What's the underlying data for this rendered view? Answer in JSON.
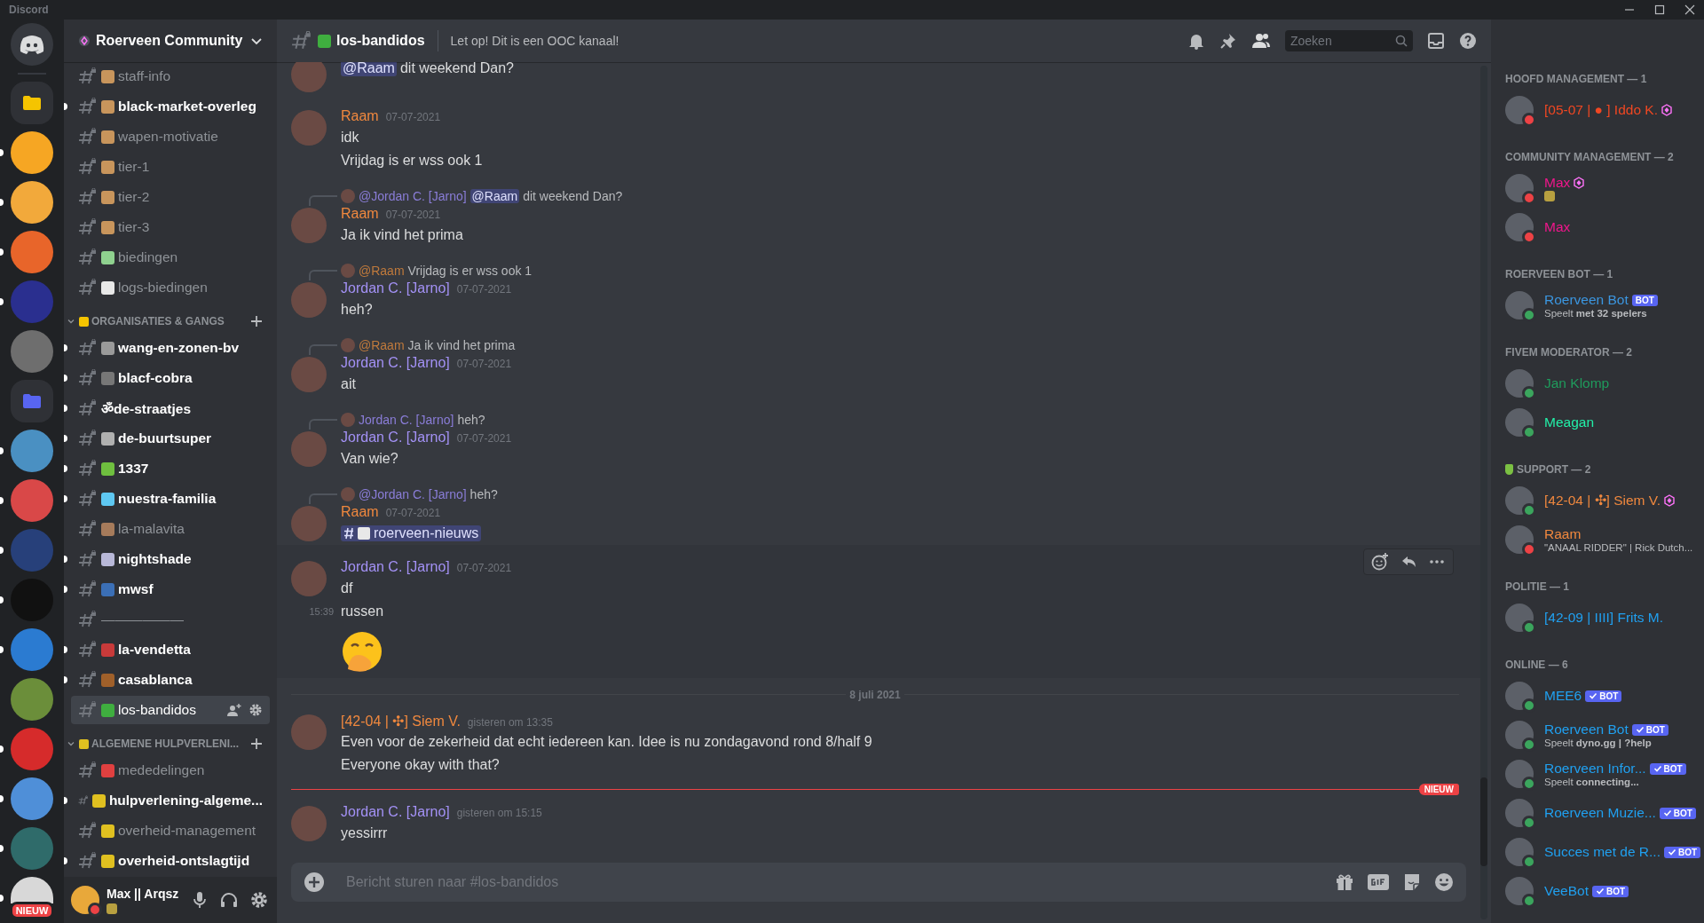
{
  "window": {
    "title": "Discord"
  },
  "servers": [
    {
      "kind": "home",
      "unread": false,
      "color": "#36393f"
    },
    {
      "kind": "folder",
      "unread": false,
      "color": "#f5c400"
    },
    {
      "kind": "server",
      "unread": true,
      "color": "#f6a623"
    },
    {
      "kind": "server",
      "unread": true,
      "color": "#f2a93b"
    },
    {
      "kind": "server",
      "unread": true,
      "color": "#e8652a"
    },
    {
      "kind": "server",
      "unread": true,
      "color": "#2a2f8f"
    },
    {
      "kind": "server",
      "unread": false,
      "color": "#6e6e6e"
    },
    {
      "kind": "folder",
      "unread": false,
      "color": "#5865f2"
    },
    {
      "kind": "server",
      "unread": true,
      "color": "#4a90c2"
    },
    {
      "kind": "server",
      "unread": true,
      "color": "#d94848"
    },
    {
      "kind": "server",
      "unread": true,
      "color": "#27407a"
    },
    {
      "kind": "server",
      "unread": true,
      "color": "#111111"
    },
    {
      "kind": "server",
      "unread": true,
      "color": "#2b7bd1"
    },
    {
      "kind": "server",
      "unread": false,
      "color": "#6b8e3a"
    },
    {
      "kind": "server",
      "unread": true,
      "color": "#d62b2b"
    },
    {
      "kind": "server",
      "unread": true,
      "color": "#4f8fd8"
    },
    {
      "kind": "server",
      "unread": true,
      "color": "#2f6b6a"
    },
    {
      "kind": "server",
      "unread": true,
      "color": "#d8d8d8",
      "badge": "NIEUW"
    }
  ],
  "server": {
    "name": "Roerveen Community"
  },
  "sections": [
    {
      "channels": [
        {
          "name": "staff-info",
          "unread": false,
          "selected": false,
          "color": "#c8955c"
        },
        {
          "name": "black-market-overleg",
          "unread": true,
          "selected": false,
          "color": "#c8955c"
        },
        {
          "name": "wapen-motivatie",
          "unread": false,
          "selected": false,
          "color": "#c8955c"
        },
        {
          "name": "tier-1",
          "unread": false,
          "selected": false,
          "color": "#c8955c"
        },
        {
          "name": "tier-2",
          "unread": false,
          "selected": false,
          "color": "#c8955c"
        },
        {
          "name": "tier-3",
          "unread": false,
          "selected": false,
          "color": "#c8955c"
        },
        {
          "name": "biedingen",
          "unread": false,
          "selected": false,
          "color": "#8fd18f"
        },
        {
          "name": "logs-biedingen",
          "unread": false,
          "selected": false,
          "color": "#e8e8e8"
        }
      ]
    },
    {
      "title": "ORGANISATIES & GANGS",
      "expanded": true,
      "color": "#f5c400",
      "channels": [
        {
          "name": "wang-en-zonen-bv",
          "unread": true,
          "selected": false,
          "color": "#9a9a9a"
        },
        {
          "name": "blacf-cobra",
          "unread": true,
          "selected": false,
          "color": "#777777"
        },
        {
          "name": "ॐde-straatjes",
          "unread": true,
          "selected": false
        },
        {
          "name": "de-buurtsuper",
          "unread": true,
          "selected": false,
          "color": "#b0b0b0"
        },
        {
          "name": "1337",
          "unread": true,
          "selected": false,
          "color": "#6fbf3f"
        },
        {
          "name": "nuestra-familia",
          "unread": true,
          "selected": false,
          "color": "#5ec8f2"
        },
        {
          "name": "la-malavita",
          "unread": false,
          "selected": false,
          "color": "#a67b5b"
        },
        {
          "name": "nightshade",
          "unread": true,
          "selected": false,
          "color": "#b8b8d8"
        },
        {
          "name": "mwsf",
          "unread": true,
          "selected": false,
          "color": "#3b6fb6"
        },
        {
          "name": "——————",
          "unread": false,
          "selected": false
        },
        {
          "name": "la-vendetta",
          "unread": true,
          "selected": false,
          "color": "#c83a3a"
        },
        {
          "name": "casablanca",
          "unread": true,
          "selected": false,
          "color": "#a0602a"
        },
        {
          "name": "los-bandidos",
          "unread": false,
          "selected": true,
          "color": "#3fae3f"
        }
      ]
    },
    {
      "title": "ALGEMENE HULPVERLENI...",
      "expanded": true,
      "color": "#e0c020",
      "channels": [
        {
          "name": "mededelingen",
          "unread": false,
          "selected": false,
          "color": "#e04040"
        },
        {
          "name": "hulpverlening-algeme...",
          "unread": true,
          "selected": false,
          "color": "#e0c020"
        },
        {
          "name": "overheid-management",
          "unread": false,
          "selected": false,
          "color": "#e0c020"
        },
        {
          "name": "overheid-ontslagtijd",
          "unread": true,
          "selected": false,
          "color": "#e0c020"
        }
      ]
    }
  ],
  "user": {
    "name": "Max || Arqsz",
    "dnd": true
  },
  "header": {
    "channel": "los-bandidos",
    "topic": "Let op! Dit is een OOC kanaal!",
    "search_placeholder": "Zoeken"
  },
  "messages": [
    {
      "kind": "message",
      "hovered": false,
      "lines": [
        {
          "kind": "text",
          "mention": "@Raam",
          "text": "dit weekend Dan?"
        }
      ]
    },
    {
      "kind": "message",
      "author": "Raam",
      "color": "#f0883e",
      "time": "07-07-2021",
      "hovered": false,
      "lines": [
        {
          "kind": "text",
          "text": "idk"
        },
        {
          "kind": "text",
          "text": "Vrijdag is er wss ook 1"
        }
      ]
    },
    {
      "kind": "message",
      "author": "Raam",
      "color": "#f0883e",
      "time": "07-07-2021",
      "hovered": false,
      "reply": {
        "author": "@Jordan C. [Jarno]",
        "color": "#8a7dd8",
        "mention": "@Raam",
        "text": "dit weekend Dan?"
      },
      "lines": [
        {
          "kind": "text",
          "text": "Ja ik vind het prima"
        }
      ]
    },
    {
      "kind": "message",
      "author": "Jordan C. [Jarno]",
      "color": "#a391f5",
      "time": "07-07-2021",
      "hovered": false,
      "reply": {
        "author": "@Raam",
        "color": "#c07a3c",
        "text": "Vrijdag is er wss ook 1"
      },
      "lines": [
        {
          "kind": "text",
          "text": "heh?"
        }
      ]
    },
    {
      "kind": "message",
      "author": "Jordan C. [Jarno]",
      "color": "#a391f5",
      "time": "07-07-2021",
      "hovered": false,
      "reply": {
        "author": "@Raam",
        "color": "#c07a3c",
        "text": "Ja ik vind het prima"
      },
      "lines": [
        {
          "kind": "text",
          "text": "ait"
        }
      ]
    },
    {
      "kind": "message",
      "author": "Jordan C. [Jarno]",
      "color": "#a391f5",
      "time": "07-07-2021",
      "hovered": false,
      "reply": {
        "author": "Jordan C. [Jarno]",
        "color": "#8a7dd8",
        "text": "heh?"
      },
      "lines": [
        {
          "kind": "text",
          "text": "Van wie?"
        }
      ]
    },
    {
      "kind": "message",
      "author": "Raam",
      "color": "#f0883e",
      "time": "07-07-2021",
      "hovered": false,
      "reply": {
        "author": "@Jordan C. [Jarno]",
        "color": "#8a7dd8",
        "text": "heh?"
      },
      "lines": [
        {
          "kind": "channel_link",
          "text": "roerveen-nieuws"
        }
      ]
    },
    {
      "kind": "message",
      "author": "Jordan C. [Jarno]",
      "color": "#a391f5",
      "time": "07-07-2021",
      "hovered": true,
      "lines": [
        {
          "kind": "text",
          "text": "df"
        },
        {
          "kind": "text",
          "text": "russen",
          "time": "15:39"
        },
        {
          "kind": "emoji"
        }
      ]
    },
    {
      "kind": "date_divider",
      "text": "8 juli 2021"
    },
    {
      "kind": "message",
      "author": "[42-04 | ✣] Siem V.",
      "color": "#f0883e",
      "time": "gisteren om 13:35",
      "hovered": false,
      "lines": [
        {
          "kind": "text",
          "text": "Even voor de zekerheid dat echt iedereen kan. Idee is nu zondagavond rond 8/half 9"
        },
        {
          "kind": "text",
          "text": "Everyone okay with that?"
        }
      ]
    },
    {
      "kind": "new_divider",
      "text": "NIEUW"
    },
    {
      "kind": "message",
      "author": "Jordan C. [Jarno]",
      "color": "#a391f5",
      "time": "gisteren om 15:15",
      "hovered": false,
      "lines": [
        {
          "kind": "text",
          "text": "yessirrr"
        }
      ]
    }
  ],
  "composer": {
    "placeholder": "Bericht sturen naar #los-bandidos"
  },
  "member_groups": [
    {
      "title": "HOOFD MANAGEMENT — 1",
      "icon": false,
      "members": [
        {
          "name": "[05-07 | ● ] Iddo K.",
          "color": "#f04722",
          "dnd": true,
          "boost": true,
          "status_icon": false
        }
      ]
    },
    {
      "title": "COMMUNITY MANAGEMENT — 2",
      "icon": false,
      "members": [
        {
          "name": "Max",
          "color": "#f0168c",
          "dnd": true,
          "boost": true,
          "status_icon": true
        },
        {
          "name": "Max",
          "color": "#f0168c",
          "dnd": true,
          "boost": false,
          "status_icon": false
        }
      ]
    },
    {
      "title": "ROERVEEN BOT — 1",
      "icon": false,
      "members": [
        {
          "name": "Roerveen Bot",
          "color": "#3b96e0",
          "dnd": false,
          "boost": false,
          "status_icon": false,
          "bot": {
            "label": "BOT",
            "verified": false
          },
          "activity": "Speelt **met 32 spelers**"
        }
      ]
    },
    {
      "title": "FIVEM MODERATOR — 2",
      "icon": false,
      "members": [
        {
          "name": "Jan Klomp",
          "color": "#1f9b5c",
          "dnd": false,
          "boost": false,
          "status_icon": false
        },
        {
          "name": "Meagan",
          "color": "#22f0a8",
          "dnd": false,
          "boost": false,
          "status_icon": false
        }
      ]
    },
    {
      "title": "SUPPORT — 2",
      "icon": true,
      "members": [
        {
          "name": "[42-04 | ✣] Siem V.",
          "color": "#f0883e",
          "dnd": false,
          "boost": true,
          "status_icon": false
        },
        {
          "name": "Raam",
          "color": "#f0883e",
          "dnd": true,
          "boost": false,
          "status_icon": false,
          "activity": "\"ANAAL RIDDER\" | Rick Dutch..."
        }
      ]
    },
    {
      "title": "POLITIE — 1",
      "icon": false,
      "members": [
        {
          "name": "[42-09 | IIII] Frits M.",
          "color": "#20a0f0",
          "dnd": false,
          "boost": false,
          "status_icon": false
        }
      ]
    },
    {
      "title": "ONLINE — 6",
      "icon": false,
      "members": [
        {
          "name": "MEE6",
          "color": "#20a0f0",
          "dnd": false,
          "boost": false,
          "status_icon": false,
          "bot": {
            "label": "BOT",
            "verified": true
          }
        },
        {
          "name": "Roerveen Bot",
          "color": "#20a0f0",
          "dnd": false,
          "boost": false,
          "status_icon": false,
          "bot": {
            "label": "BOT",
            "verified": true
          },
          "activity": "Speelt **dyno.gg | ?help**"
        },
        {
          "name": "Roerveen Infor...",
          "color": "#20a0f0",
          "dnd": false,
          "boost": false,
          "status_icon": false,
          "bot": {
            "label": "BOT",
            "verified": true
          },
          "activity": "Speelt **connecting...**"
        },
        {
          "name": "Roerveen Muzie...",
          "color": "#20a0f0",
          "dnd": false,
          "boost": false,
          "status_icon": false,
          "bot": {
            "label": "BOT",
            "verified": true
          }
        },
        {
          "name": "Succes met de R...",
          "color": "#20a0f0",
          "dnd": false,
          "boost": false,
          "status_icon": false,
          "bot": {
            "label": "BOT",
            "verified": true
          }
        },
        {
          "name": "VeeBot",
          "color": "#20a0f0",
          "dnd": false,
          "boost": false,
          "status_icon": false,
          "bot": {
            "label": "BOT",
            "verified": true
          }
        }
      ]
    }
  ]
}
